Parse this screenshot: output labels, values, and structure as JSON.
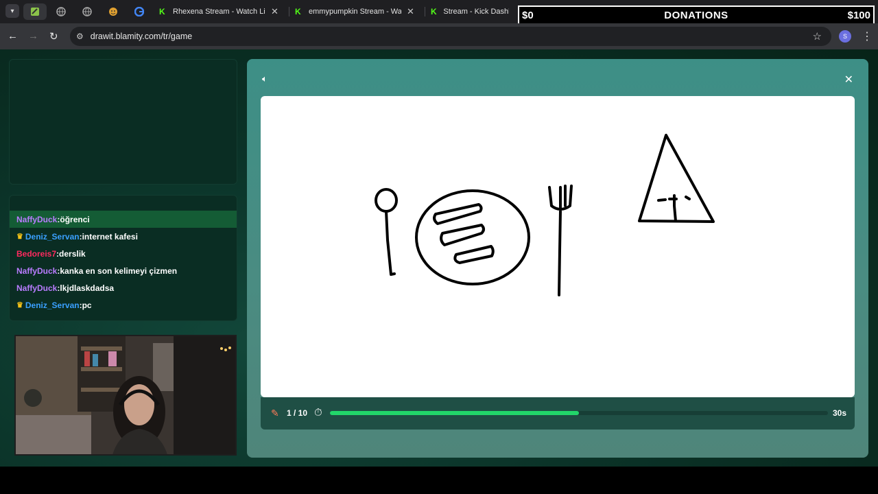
{
  "browser": {
    "tabs": [
      {
        "title": "Rhexena Stream - Watch Live o"
      },
      {
        "title": "emmypumpkin Stream - Watch"
      },
      {
        "title": "Stream - Kick Dashboard"
      }
    ],
    "url": "drawit.blamity.com/tr/game",
    "profile_initial": "S"
  },
  "donations": {
    "current": "$0",
    "label": "DONATIONS",
    "goal": "$100"
  },
  "chat": {
    "messages": [
      {
        "user": "NaffyDuck",
        "text": "öğrenci",
        "color": "#b97cff",
        "crown": false,
        "highlight": true
      },
      {
        "user": "Deniz_Servan",
        "text": "internet kafesi",
        "color": "#3aa0ff",
        "crown": true,
        "highlight": false
      },
      {
        "user": "Bedoreis7",
        "text": "derslik",
        "color": "#ff2a5f",
        "crown": false,
        "highlight": false
      },
      {
        "user": "NaffyDuck",
        "text": "kanka en son kelimeyi çizmen",
        "color": "#b97cff",
        "crown": false,
        "highlight": false
      },
      {
        "user": "NaffyDuck",
        "text": "lkjdlaskdadsa",
        "color": "#b97cff",
        "crown": false,
        "highlight": false
      },
      {
        "user": "Deniz_Servan",
        "text": "pc",
        "color": "#3aa0ff",
        "crown": true,
        "highlight": false
      }
    ]
  },
  "game": {
    "round": "1 / 10",
    "time_left": "30s",
    "progress": 0.5,
    "icons": {
      "sound": "speaker-icon",
      "close": "close-icon",
      "pencil": "pencil-icon",
      "timer": "stopwatch-icon"
    }
  },
  "colors": {
    "accent_green": "#22d66a",
    "kick_green": "#53fc18"
  }
}
